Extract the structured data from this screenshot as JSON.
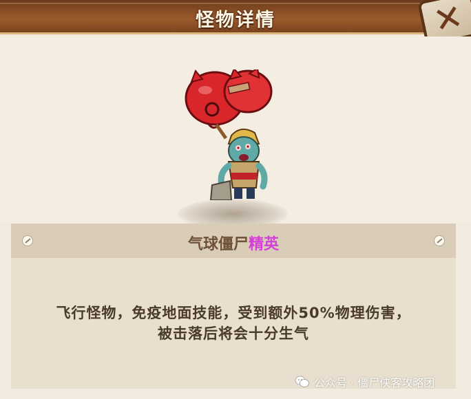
{
  "header": {
    "title": "怪物详情",
    "close_icon": "close-x-icon"
  },
  "monster": {
    "name": "气球僵尸",
    "rank": "精英",
    "description_lines": [
      "飞行怪物，免疫地面技能，受到额外50%物理伤害，",
      "被击落后将会十分生气"
    ]
  },
  "watermark": {
    "text": "公众号 · 僵尸侠客攻略团",
    "icon": "wechat-icon"
  },
  "colors": {
    "header_bg": "#8a4f26",
    "panel_bg": "#e8dfce",
    "name_bar_bg": "#d9cdb8",
    "elite": "#d43fd8",
    "text": "#4a3a2c"
  }
}
